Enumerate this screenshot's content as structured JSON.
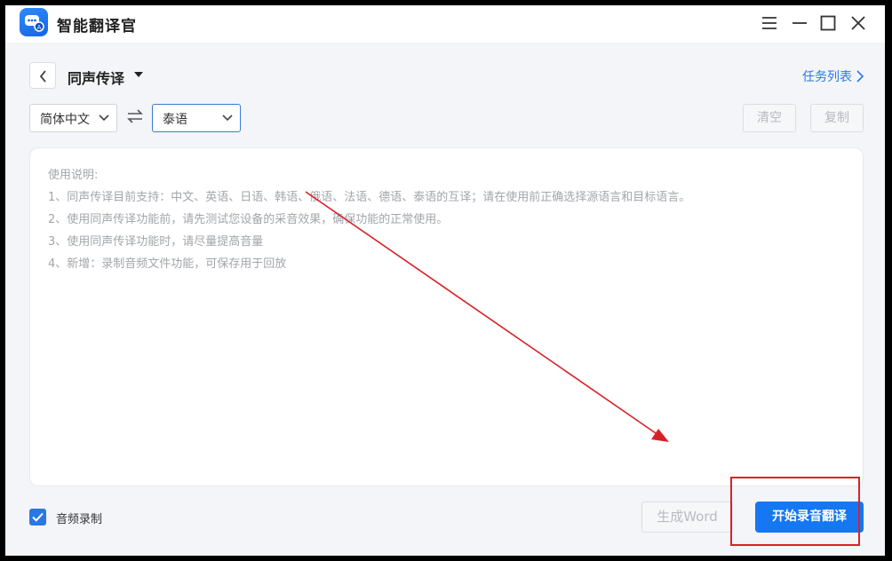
{
  "app": {
    "title": "智能翻译官"
  },
  "window_controls": [
    "menu-icon",
    "minimize-icon",
    "maximize-icon",
    "close-icon"
  ],
  "header": {
    "title": "同声传译",
    "task_link": "任务列表"
  },
  "languages": {
    "source": "简体中文",
    "target": "泰语"
  },
  "actions": {
    "clear": "清空",
    "copy": "复制"
  },
  "instructions": [
    "使用说明:",
    "1、同声传译目前支持：中文、英语、日语、韩语、俄语、法语、德语、泰语的互译；请在使用前正确选择源语言和目标语言。",
    "2、使用同声传译功能前，请先测试您设备的采音效果，确保功能的正常使用。",
    "3、使用同声传译功能时，请尽量提高音量",
    "4、新增：录制音频文件功能，可保存用于回放"
  ],
  "footer": {
    "audio_record_label": "音频录制",
    "audio_record_checked": true,
    "word_button": "生成Word",
    "start_button": "开始录音翻译"
  },
  "colors": {
    "accent": "#1677f2",
    "annotation": "#d6232a"
  }
}
